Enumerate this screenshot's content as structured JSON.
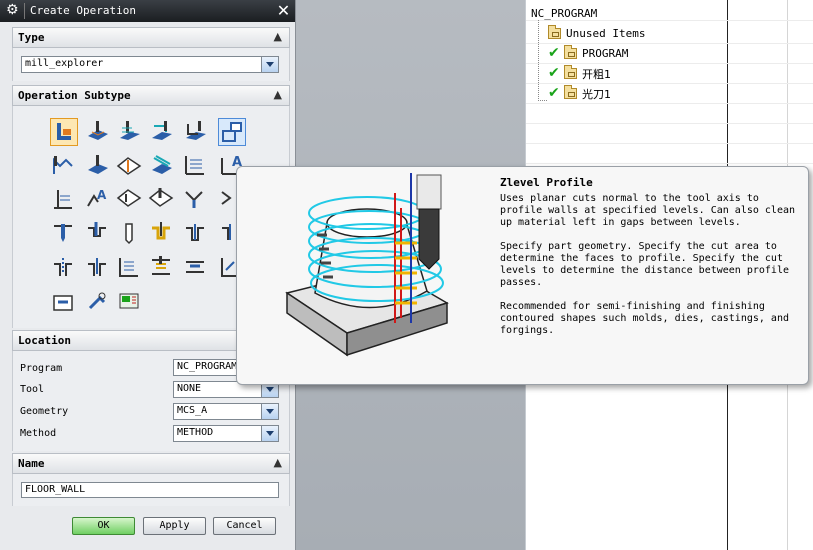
{
  "dialog": {
    "title": "Create Operation",
    "type_section": {
      "label": "Type",
      "value": "mill_explorer"
    },
    "subtype_section": {
      "label": "Operation Subtype"
    },
    "location_section": {
      "label": "Location",
      "rows": [
        {
          "label": "Program",
          "value": "NC_PROGRAM"
        },
        {
          "label": "Tool",
          "value": "NONE"
        },
        {
          "label": "Geometry",
          "value": "MCS_A"
        },
        {
          "label": "Method",
          "value": "METHOD"
        }
      ]
    },
    "name_section": {
      "label": "Name",
      "value": "FLOOR_WALL"
    },
    "buttons": {
      "ok": "OK",
      "apply": "Apply",
      "cancel": "Cancel"
    }
  },
  "tooltip": {
    "title": "Zlevel Profile",
    "paragraphs": [
      "Uses planar cuts normal to the tool axis to profile walls at specified levels. Can also clean up material left in gaps between levels.",
      "Specify part geometry. Specify the cut area to determine the faces to profile. Specify the cut levels to determine the distance between profile passes.",
      "Recommended for semi-finishing and finishing contoured shapes such molds, dies, castings, and forgings."
    ]
  },
  "navigator": {
    "root": "NC_PROGRAM",
    "items": [
      {
        "label": "Unused Items",
        "status": "none"
      },
      {
        "label": "PROGRAM",
        "status": "check"
      },
      {
        "label": "开粗1",
        "status": "check"
      },
      {
        "label": "光刀1",
        "status": "check"
      }
    ]
  },
  "colors": {
    "title_bar": "#1b1e21",
    "ok_button": "#6fcf62",
    "check": "#1aa31a",
    "selected_icon": "#fde7b3"
  }
}
